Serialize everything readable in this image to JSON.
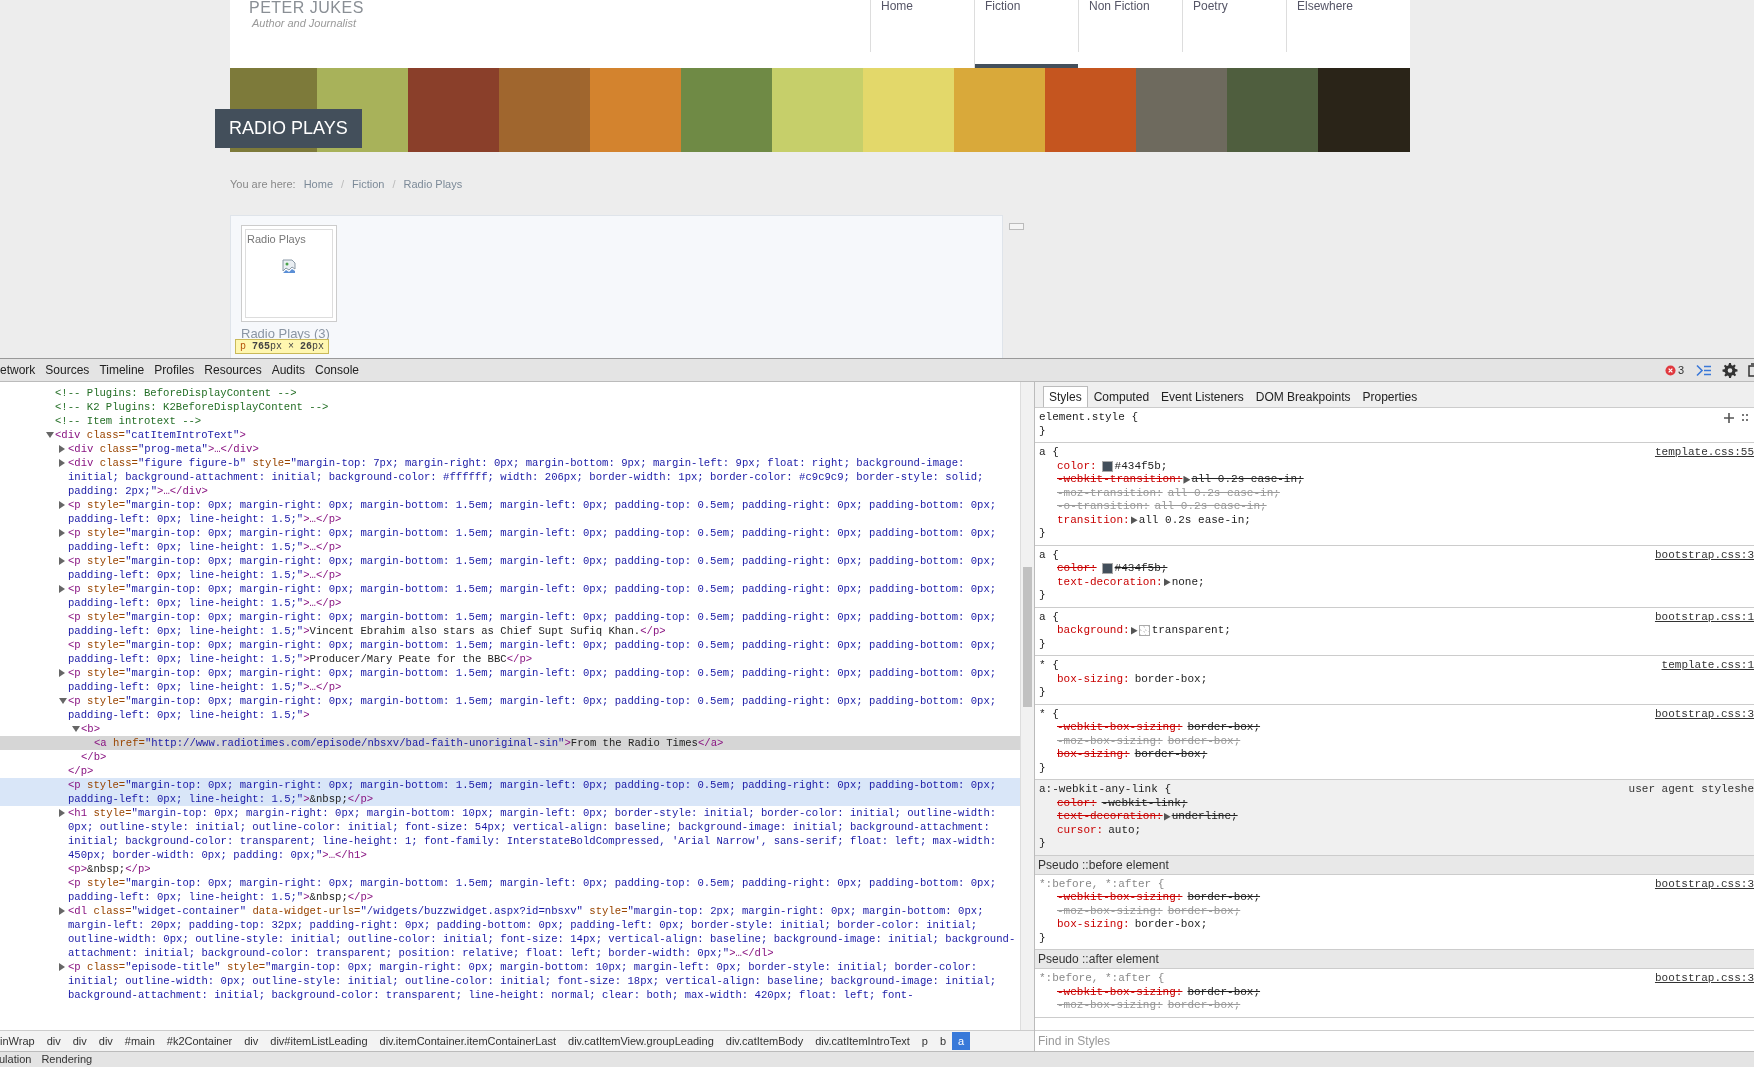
{
  "site": {
    "title": "PETER JUKES",
    "tagline": "Author and Journalist",
    "nav": [
      {
        "label": "Home",
        "selected": false
      },
      {
        "label": "Fiction",
        "selected": true
      },
      {
        "label": "Non Fiction",
        "selected": false
      },
      {
        "label": "Poetry",
        "selected": false
      },
      {
        "label": "Elsewhere",
        "selected": false
      }
    ],
    "banner_title": "RADIO PLAYS",
    "breadcrumb": {
      "prefix": "You are here:",
      "items": [
        "Home",
        "Fiction",
        "Radio Plays"
      ],
      "separators": [
        "/",
        "/"
      ]
    },
    "category": {
      "card_title": "Radio Plays",
      "title": "Radio Plays (3)"
    },
    "inspect_tooltip": {
      "tag": "p",
      "size": "**765**px × **26**px"
    }
  },
  "devtools": {
    "tabs": [
      {
        "label": "etwork",
        "selected": false
      },
      {
        "label": "Sources",
        "selected": false
      },
      {
        "label": "Timeline",
        "selected": false
      },
      {
        "label": "Profiles",
        "selected": false
      },
      {
        "label": "Resources",
        "selected": false
      },
      {
        "label": "Audits",
        "selected": false
      },
      {
        "label": "Console",
        "selected": false
      }
    ],
    "error_count": "3",
    "dom": [
      {
        "kind": "comment",
        "open": "<!-- Plugins: BeforeDisplayContent -->",
        "selected": false,
        "hovered": false
      },
      {
        "kind": "comment",
        "open": "<!-- K2 Plugins: K2BeforeDisplayContent -->",
        "selected": false,
        "hovered": false
      },
      {
        "kind": "comment",
        "open": "<!-- Item introtext -->",
        "selected": false,
        "hovered": false
      },
      {
        "kind": "node",
        "expanded": true,
        "open": "<div class=\"catItemIntroText\">",
        "selected": false,
        "hovered": false,
        "children": [
          {
            "kind": "node",
            "expanded": false,
            "open": "<div class=\"prog-meta\">…</div>",
            "selected": false,
            "hovered": false
          },
          {
            "kind": "node",
            "expanded": false,
            "open": "<div class=\"figure figure-b\" style=\"margin-top: 7px; margin-right: 0px; margin-bottom: 9px; margin-left: 9px; float: right; background-image: initial; background-attachment: initial; background-color: #ffffff; width: 206px; border-width: 1px; border-color: #c9c9c9; border-style: solid; padding: 2px;\">…</div>",
            "selected": false,
            "hovered": false
          },
          {
            "kind": "node",
            "expanded": false,
            "open": "<p style=\"margin-top: 0px; margin-right: 0px; margin-bottom: 1.5em; margin-left: 0px; padding-top: 0.5em; padding-right: 0px; padding-bottom: 0px; padding-left: 0px; line-height: 1.5;\">…</p>",
            "selected": false,
            "hovered": false
          },
          {
            "kind": "node",
            "expanded": false,
            "open": "<p style=\"margin-top: 0px; margin-right: 0px; margin-bottom: 1.5em; margin-left: 0px; padding-top: 0.5em; padding-right: 0px; padding-bottom: 0px; padding-left: 0px; line-height: 1.5;\">…</p>",
            "selected": false,
            "hovered": false
          },
          {
            "kind": "node",
            "expanded": false,
            "open": "<p style=\"margin-top: 0px; margin-right: 0px; margin-bottom: 1.5em; margin-left: 0px; padding-top: 0.5em; padding-right: 0px; padding-bottom: 0px; padding-left: 0px; line-height: 1.5;\">…</p>",
            "selected": false,
            "hovered": false
          },
          {
            "kind": "node",
            "expanded": false,
            "open": "<p style=\"margin-top: 0px; margin-right: 0px; margin-bottom: 1.5em; margin-left: 0px; padding-top: 0.5em; padding-right: 0px; padding-bottom: 0px; padding-left: 0px; line-height: 1.5;\">…</p>",
            "selected": false,
            "hovered": false
          },
          {
            "kind": "leaf",
            "open": "<p style=\"margin-top: 0px; margin-right: 0px; margin-bottom: 1.5em; margin-left: 0px; padding-top: 0.5em; padding-right: 0px; padding-bottom: 0px; padding-left: 0px; line-height: 1.5;\">",
            "text": "Vincent Ebrahim also stars as Chief Supt Sufiq Khan.",
            "close": "</p>",
            "selected": false,
            "hovered": false
          },
          {
            "kind": "leaf",
            "open": "<p style=\"margin-top: 0px; margin-right: 0px; margin-bottom: 1.5em; margin-left: 0px; padding-top: 0.5em; padding-right: 0px; padding-bottom: 0px; padding-left: 0px; line-height: 1.5;\">",
            "text": "Producer/Mary Peate for the BBC",
            "close": "</p>",
            "selected": false,
            "hovered": false
          },
          {
            "kind": "node",
            "expanded": false,
            "open": "<p style=\"margin-top: 0px; margin-right: 0px; margin-bottom: 1.5em; margin-left: 0px; padding-top: 0.5em; padding-right: 0px; padding-bottom: 0px; padding-left: 0px; line-height: 1.5;\">…</p>",
            "selected": false,
            "hovered": false
          },
          {
            "kind": "node",
            "expanded": true,
            "open": "<p style=\"margin-top: 0px; margin-right: 0px; margin-bottom: 1.5em; margin-left: 0px; padding-top: 0.5em; padding-right: 0px; padding-bottom: 0px; padding-left: 0px; line-height: 1.5;\">",
            "close": "</p>",
            "selected": false,
            "hovered": false,
            "children": [
              {
                "kind": "node",
                "expanded": true,
                "open": "<b>",
                "close": "</b>",
                "selected": false,
                "hovered": false,
                "children": [
                  {
                    "kind": "leaf",
                    "open": "<a href=\"http://www.radiotimes.com/episode/nbsxv/bad-faith-unoriginal-sin\">",
                    "text": "From the Radio Times",
                    "close": "</a>",
                    "selected": true,
                    "hovered": false
                  }
                ]
              }
            ]
          },
          {
            "kind": "leaf",
            "open": "<p style=\"margin-top: 0px; margin-right: 0px; margin-bottom: 1.5em; margin-left: 0px; padding-top: 0.5em; padding-right: 0px; padding-bottom: 0px; padding-left: 0px; line-height: 1.5;\">",
            "text": "&nbsp;",
            "close": "</p>",
            "selected": false,
            "hovered": true
          },
          {
            "kind": "node",
            "expanded": false,
            "open": "<h1 style=\"margin-top: 0px; margin-right: 0px; margin-bottom: 10px; margin-left: 0px; border-style: initial; border-color: initial; outline-width: 0px; outline-style: initial; outline-color: initial; font-size: 54px; vertical-align: baseline; background-image: initial; background-attachment: initial; background-color: transparent; line-height: 1; font-family: InterstateBoldCompressed, 'Arial Narrow', sans-serif; float: left; max-width: 450px; border-width: 0px; padding: 0px;\">…</h1>",
            "selected": false,
            "hovered": false
          },
          {
            "kind": "leaf",
            "open": "<p>",
            "text": "&nbsp;",
            "close": "</p>",
            "selected": false,
            "hovered": false
          },
          {
            "kind": "leaf",
            "open": "<p style=\"margin-top: 0px; margin-right: 0px; margin-bottom: 1.5em; margin-left: 0px; padding-top: 0.5em; padding-right: 0px; padding-bottom: 0px; padding-left: 0px; line-height: 1.5;\">",
            "text": "&nbsp;",
            "close": "</p>",
            "selected": false,
            "hovered": false
          },
          {
            "kind": "node",
            "expanded": false,
            "open": "<dl class=\"widget-container\" data-widget-urls=\"/widgets/buzzwidget.aspx?id=nbsxv\" style=\"margin-top: 2px; margin-right: 0px; margin-bottom: 0px; margin-left: 20px; padding-top: 32px; padding-right: 0px; padding-bottom: 0px; padding-left: 0px; border-style: initial; border-color: initial; outline-width: 0px; outline-style: initial; outline-color: initial; font-size: 14px; vertical-align: baseline; background-image: initial; background-attachment: initial; background-color: transparent; position: relative; float: left; border-width: 0px;\">…</dl>",
            "selected": false,
            "hovered": false
          },
          {
            "kind": "node",
            "expanded": false,
            "open": "<p class=\"episode-title\" style=\"margin-top: 0px; margin-right: 0px; margin-bottom: 10px; margin-left: 0px; border-style: initial; border-color: initial; outline-width: 0px; outline-style: initial; outline-color: initial; font-size: 18px; vertical-align: baseline; background-image: initial; background-attachment: initial; background-color: transparent; line-height: normal; clear: both; max-width: 420px; float: left; font-",
            "selected": false,
            "hovered": false
          }
        ]
      }
    ],
    "breadcrumbs": [
      {
        "label": "inWrap",
        "selected": false
      },
      {
        "label": "div",
        "selected": false
      },
      {
        "label": "div",
        "selected": false
      },
      {
        "label": "div",
        "selected": false
      },
      {
        "label": "#main",
        "selected": false
      },
      {
        "label": "#k2Container",
        "selected": false
      },
      {
        "label": "div",
        "selected": false
      },
      {
        "label": "div#itemListLeading",
        "selected": false
      },
      {
        "label": "div.itemContainer.itemContainerLast",
        "selected": false
      },
      {
        "label": "div.catItemView.groupLeading",
        "selected": false
      },
      {
        "label": "div.catItemBody",
        "selected": false
      },
      {
        "label": "div.catItemIntroText",
        "selected": false
      },
      {
        "label": "p",
        "selected": false
      },
      {
        "label": "b",
        "selected": false
      },
      {
        "label": "a",
        "selected": true
      }
    ],
    "styles_tabs": [
      {
        "label": "Styles",
        "selected": true
      },
      {
        "label": "Computed",
        "selected": false
      },
      {
        "label": "Event Listeners",
        "selected": false
      },
      {
        "label": "DOM Breakpoints",
        "selected": false
      },
      {
        "label": "Properties",
        "selected": false
      }
    ],
    "styles": [
      {
        "kind": "rule",
        "selector": "element.style {",
        "close": "}",
        "inline": true,
        "user_agent": false,
        "matched": true
      },
      {
        "kind": "rule",
        "selector": "a {",
        "source": "template.css:55",
        "close": "}",
        "user_agent": false,
        "matched": true,
        "props": [
          {
            "name": "color:",
            "value": "#434f5b;",
            "overridden": false,
            "inactive": false,
            "swatch": true
          },
          {
            "name": "-webkit-transition:",
            "value": "all 0.2s ease-in;",
            "overridden": true,
            "inactive": false,
            "arrow": true
          },
          {
            "name": "-moz-transition:",
            "value": "all 0.2s ease-in;",
            "overridden": true,
            "inactive": true
          },
          {
            "name": "-o-transition:",
            "value": "all 0.2s ease-in;",
            "overridden": true,
            "inactive": true
          },
          {
            "name": "transition:",
            "value": "all 0.2s ease-in;",
            "overridden": false,
            "inactive": false,
            "arrow": true
          }
        ]
      },
      {
        "kind": "rule",
        "selector": "a {",
        "source": "bootstrap.css:3",
        "close": "}",
        "user_agent": false,
        "matched": true,
        "props": [
          {
            "name": "color:",
            "value": "#434f5b;",
            "overridden": true,
            "inactive": false,
            "swatch": true
          },
          {
            "name": "text-decoration:",
            "value": "none;",
            "overridden": false,
            "inactive": false,
            "arrow": true
          }
        ]
      },
      {
        "kind": "rule",
        "selector": "a {",
        "source": "bootstrap.css:1",
        "close": "}",
        "user_agent": false,
        "matched": true,
        "props": [
          {
            "name": "background:",
            "value": "transparent;",
            "overridden": false,
            "inactive": false,
            "arrow": true,
            "swatch": true
          }
        ]
      },
      {
        "kind": "rule",
        "selector": "* {",
        "source": "template.css:1",
        "close": "}",
        "user_agent": false,
        "matched": true,
        "props": [
          {
            "name": "box-sizing:",
            "value": "border-box;",
            "overridden": false,
            "inactive": false
          }
        ]
      },
      {
        "kind": "rule",
        "selector": "* {",
        "source": "bootstrap.css:3",
        "close": "}",
        "user_agent": false,
        "matched": true,
        "props": [
          {
            "name": "-webkit-box-sizing:",
            "value": "border-box;",
            "overridden": true,
            "inactive": false
          },
          {
            "name": "-moz-box-sizing:",
            "value": "border-box;",
            "overridden": true,
            "inactive": true
          },
          {
            "name": "box-sizing:",
            "value": "border-box;",
            "overridden": true,
            "inactive": false
          }
        ]
      },
      {
        "kind": "rule",
        "selector": "a:-webkit-any-link {",
        "source": "user agent styleshe",
        "close": "}",
        "user_agent": true,
        "matched": true,
        "props": [
          {
            "name": "color:",
            "value": "-webkit-link;",
            "overridden": true,
            "inactive": false
          },
          {
            "name": "text-decoration:",
            "value": "underline;",
            "overridden": true,
            "inactive": false,
            "arrow": true
          },
          {
            "name": "cursor:",
            "value": "auto;",
            "overridden": false,
            "inactive": false
          }
        ]
      },
      {
        "kind": "section",
        "title": "Pseudo ::before element"
      },
      {
        "kind": "rule",
        "selector": "*:before, *:after {",
        "source": "bootstrap.css:3",
        "close": "}",
        "user_agent": false,
        "matched": false,
        "props": [
          {
            "name": "-webkit-box-sizing:",
            "value": "border-box;",
            "overridden": true,
            "inactive": false
          },
          {
            "name": "-moz-box-sizing:",
            "value": "border-box;",
            "overridden": true,
            "inactive": true
          },
          {
            "name": "box-sizing:",
            "value": "border-box;",
            "overridden": false,
            "inactive": false
          }
        ]
      },
      {
        "kind": "section",
        "title": "Pseudo ::after element"
      },
      {
        "kind": "rule",
        "selector": "*:before, *:after {",
        "source": "bootstrap.css:3",
        "user_agent": false,
        "matched": false,
        "props": [
          {
            "name": "-webkit-box-sizing:",
            "value": "border-box;",
            "overridden": true,
            "inactive": false
          },
          {
            "name": "-moz-box-sizing:",
            "value": "border-box;",
            "overridden": true,
            "inactive": true
          }
        ]
      }
    ],
    "find_placeholder": "Find in Styles",
    "drawer_tabs": [
      "ulation",
      "Rendering"
    ]
  }
}
